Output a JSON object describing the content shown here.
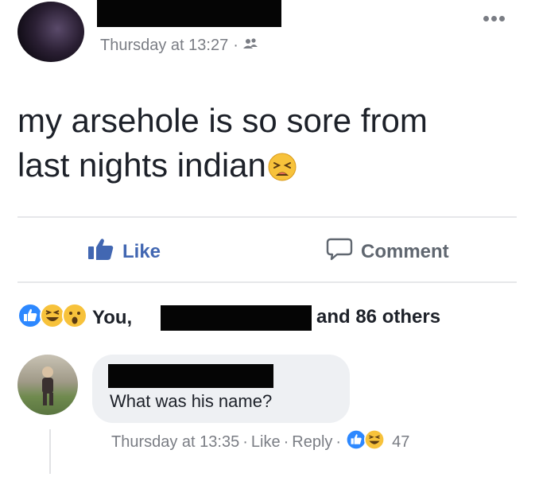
{
  "post": {
    "timestamp": "Thursday at 13:27",
    "separator": "·",
    "audience_icon": "friends-icon",
    "text_line1": "my arsehole is so sore from",
    "text_line2": "last nights indian",
    "emoji": "tired-face-emoji"
  },
  "actions": {
    "like_label": "Like",
    "comment_label": "Comment"
  },
  "reactions": {
    "icons": [
      "like-reaction",
      "haha-reaction",
      "wow-reaction"
    ],
    "names_prefix": "You,",
    "others_text": "and 86 others"
  },
  "comment": {
    "text": "What was his name?",
    "timestamp": "Thursday at 13:35",
    "like_label": "Like",
    "reply_label": "Reply",
    "reaction_count": "47",
    "sep": "·",
    "reaction_icons": [
      "like-reaction",
      "haha-reaction"
    ]
  },
  "colors": {
    "like_blue": "#4267b2",
    "muted_grey": "#7a7d84",
    "bubble_bg": "#eef0f3",
    "redaction": "#050505"
  }
}
